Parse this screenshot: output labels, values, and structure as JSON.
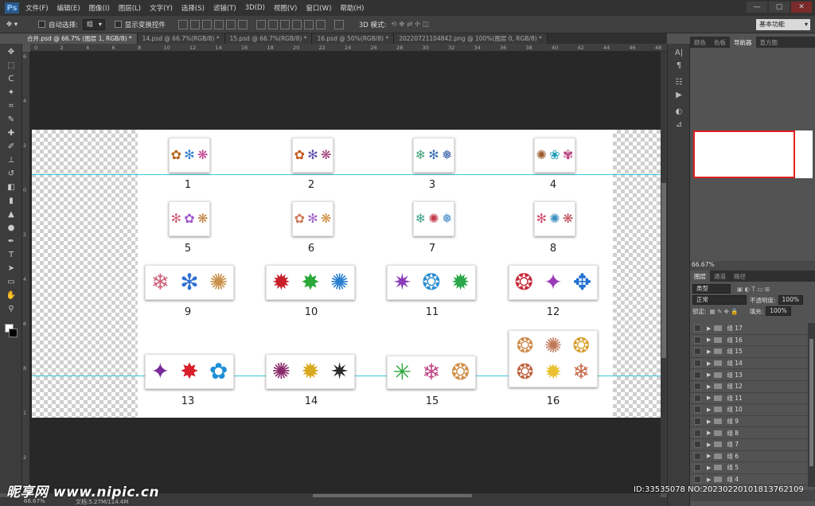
{
  "menubar": {
    "logo": "Ps",
    "items": [
      "文件(F)",
      "编辑(E)",
      "图像(I)",
      "图层(L)",
      "文字(Y)",
      "选择(S)",
      "滤镜(T)",
      "3D(D)",
      "视图(V)",
      "窗口(W)",
      "帮助(H)"
    ],
    "window_controls": [
      "—",
      "▢",
      "✕"
    ]
  },
  "options": {
    "auto_select_label": "自动选择:",
    "auto_select_value": "组",
    "show_transform_label": "显示变换控件",
    "mode_3d_label": "3D 模式:",
    "workspace": "基本功能"
  },
  "tabs": [
    {
      "label": "合并.psd @ 66.7% (图层 1, RGB/8) *",
      "active": true
    },
    {
      "label": "14.psd @ 66.7%(RGB/8) *",
      "active": false
    },
    {
      "label": "15.psd @ 66.7%(RGB/8) *",
      "active": false
    },
    {
      "label": "16.psd @ 50%(RGB/8) *",
      "active": false
    },
    {
      "label": "20220721104842.png @ 100%(图层 0, RGB/8) *",
      "active": false
    }
  ],
  "ruler_top": [
    "0",
    "2",
    "4",
    "6",
    "8",
    "10",
    "12",
    "14",
    "16",
    "18",
    "20",
    "22",
    "24",
    "26",
    "28",
    "30",
    "32",
    "34",
    "36",
    "38",
    "40",
    "42",
    "44",
    "46",
    "48"
  ],
  "ruler_left": [
    "6",
    "4",
    "2",
    "0",
    "2",
    "4",
    "6",
    "8",
    "1",
    "2"
  ],
  "canvas": {
    "items": [
      {
        "number": "1",
        "flakes": [
          "✿",
          "✻",
          "❋"
        ],
        "colors": [
          "#b5651d",
          "#2f7dd1",
          "#c03a8a"
        ]
      },
      {
        "number": "2",
        "flakes": [
          "✿",
          "✻",
          "❋"
        ],
        "colors": [
          "#c25a1e",
          "#5a4aa8",
          "#9b3f7a"
        ]
      },
      {
        "number": "3",
        "flakes": [
          "❄",
          "✻",
          "❅"
        ],
        "colors": [
          "#3f9f7a",
          "#3a6fb8",
          "#3a5fa8"
        ]
      },
      {
        "number": "4",
        "flakes": [
          "✺",
          "❀",
          "✾"
        ],
        "colors": [
          "#9a5a2a",
          "#1f9fb8",
          "#b83a7a"
        ]
      },
      {
        "number": "5",
        "flakes": [
          "✻",
          "✿",
          "❋"
        ],
        "colors": [
          "#d0607a",
          "#a05ac8",
          "#c08040"
        ]
      },
      {
        "number": "6",
        "flakes": [
          "✿",
          "✻",
          "❋"
        ],
        "colors": [
          "#d07a5a",
          "#a060c0",
          "#d08a3a"
        ]
      },
      {
        "number": "7",
        "flakes": [
          "❄",
          "✺",
          "❅"
        ],
        "colors": [
          "#3a9f8a",
          "#c03a4a",
          "#4a8fc8"
        ]
      },
      {
        "number": "8",
        "flakes": [
          "✻",
          "✺",
          "❋"
        ],
        "colors": [
          "#d04a6a",
          "#3a8fc0",
          "#c04a5a"
        ]
      },
      {
        "number": "9",
        "flakes": [
          "❄",
          "✻",
          "✺"
        ],
        "colors": [
          "#d0607a",
          "#2f6fd1",
          "#c8904a"
        ]
      },
      {
        "number": "10",
        "flakes": [
          "✹",
          "✸",
          "✺"
        ],
        "colors": [
          "#c81e2a",
          "#2aa83a",
          "#2a7fd1"
        ]
      },
      {
        "number": "11",
        "flakes": [
          "✷",
          "❂",
          "✹"
        ],
        "colors": [
          "#8a3ab8",
          "#2f8fd1",
          "#2aa84a"
        ]
      },
      {
        "number": "12",
        "flakes": [
          "❂",
          "✦",
          "✥"
        ],
        "colors": [
          "#c82a3a",
          "#9a3ab8",
          "#1f6fd1"
        ]
      },
      {
        "number": "13",
        "flakes": [
          "✦",
          "✸",
          "✿"
        ],
        "colors": [
          "#7a2a9a",
          "#d81e2a",
          "#1f8fd8"
        ]
      },
      {
        "number": "14",
        "flakes": [
          "✺",
          "✹",
          "✷"
        ],
        "colors": [
          "#8a2a6a",
          "#d8a81e",
          "#2a2a2a"
        ]
      },
      {
        "number": "15",
        "flakes": [
          "✳",
          "❄",
          "❂"
        ],
        "colors": [
          "#2aa83a",
          "#c04a8a",
          "#d0904a"
        ]
      },
      {
        "number": "16",
        "flakes": [
          "❂",
          "✺",
          "❂",
          "❂",
          "✹",
          "❄"
        ],
        "colors": [
          "#d08a4a",
          "#c07a5a",
          "#d8a030",
          "#c0603a",
          "#e8c030",
          "#c86a4a"
        ]
      }
    ]
  },
  "status": {
    "zoom": "66.67%",
    "doc": "文档:5.27M/114.4M"
  },
  "panels": {
    "top_tabs": [
      "颜色",
      "色板",
      "导航器",
      "直方图"
    ],
    "active_top_tab": "导航器",
    "nav_zoom": "66.67%",
    "layer_tabs": [
      "图层",
      "通道",
      "路径"
    ],
    "active_layer_tab": "图层",
    "kind_filter": "类型",
    "blend_mode": "正常",
    "opacity_label": "不透明度:",
    "opacity": "100%",
    "lock_label": "锁定:",
    "fill_label": "填充:",
    "fill": "100%",
    "layers": [
      "组 17",
      "组 16",
      "组 15",
      "组 14",
      "组 13",
      "组 12",
      "组 11",
      "组 10",
      "组 9",
      "组 8",
      "组 7",
      "组 6",
      "组 5",
      "组 4"
    ]
  },
  "watermark": {
    "brand": "昵享网 www.nipic.cn",
    "id": "ID:33535078 NO:20230220101813762109"
  }
}
